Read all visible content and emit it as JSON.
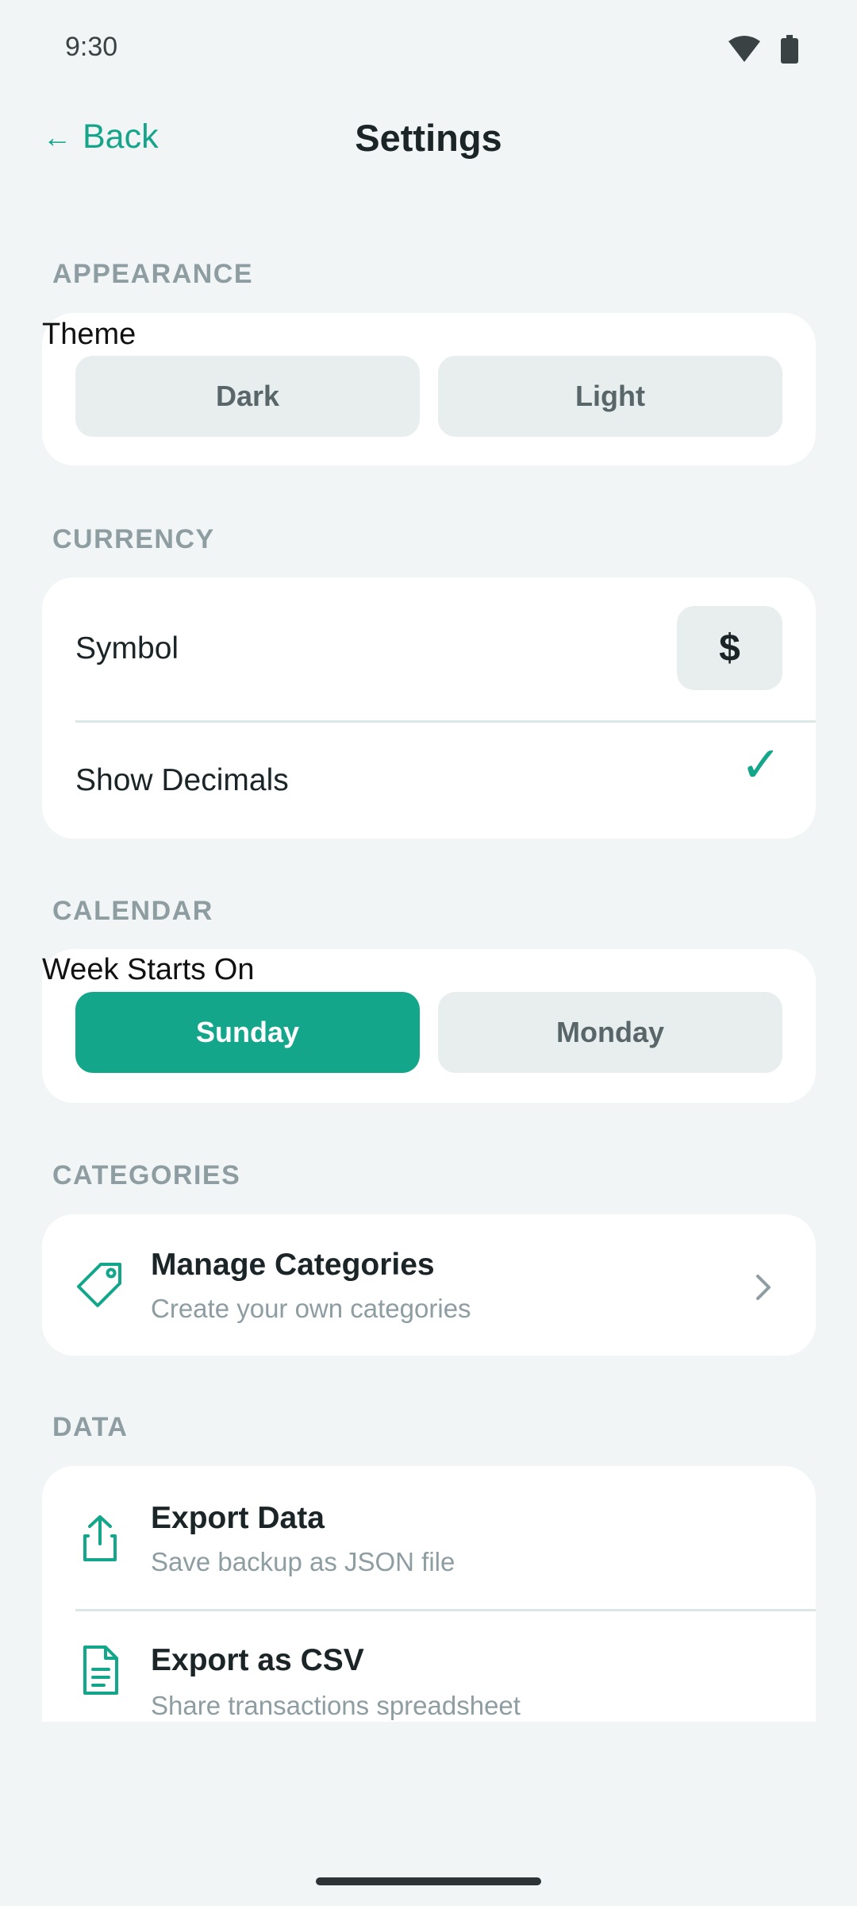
{
  "status_bar": {
    "time": "9:30",
    "icons": [
      "wifi-icon",
      "battery-icon"
    ]
  },
  "app_bar": {
    "back_arrow": "←",
    "back_label": "Back",
    "title": "Settings"
  },
  "appearance": {
    "section_label": "APPEARANCE",
    "heading": "Theme",
    "options": [
      "Dark",
      "Light"
    ],
    "selected": null
  },
  "currency": {
    "section_label": "CURRENCY",
    "symbol_label": "Symbol",
    "symbol_value": "$",
    "decimals_label": "Show Decimals",
    "decimals_enabled": true,
    "check_glyph": "✓"
  },
  "calendar": {
    "section_label": "CALENDAR",
    "heading": "Week Starts On",
    "options": [
      "Sunday",
      "Monday"
    ],
    "selected": "Sunday"
  },
  "categories": {
    "section_label": "CATEGORIES",
    "manage": {
      "icon": "tag-icon",
      "title": "Manage Categories",
      "subtitle": "Create your own categories"
    }
  },
  "data_section": {
    "section_label": "DATA",
    "export_data": {
      "icon": "share-icon",
      "title": "Export Data",
      "subtitle": "Save backup as JSON file"
    },
    "export_csv": {
      "icon": "document-icon",
      "title": "Export as CSV",
      "subtitle": "Share transactions spreadsheet"
    }
  },
  "colors": {
    "accent": "#13a68b",
    "background": "#f2f5f5",
    "card": "#ffffff",
    "muted": "#8d9da1",
    "segment": "#e8eded"
  }
}
